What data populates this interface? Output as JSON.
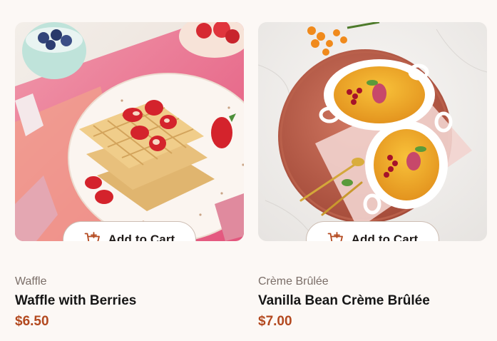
{
  "products": [
    {
      "category": "Waffle",
      "title": "Waffle with Berries",
      "price": "$6.50",
      "add_to_cart_label": "Add to Cart",
      "image_icon": "waffle-photo"
    },
    {
      "category": "Crème Brûlée",
      "title": "Vanilla Bean Crème Brûlée",
      "price": "$7.00",
      "add_to_cart_label": "Add to Cart",
      "image_icon": "creme-brulee-photo"
    }
  ],
  "colors": {
    "background": "#fcf8f5",
    "price": "#b3491f",
    "cart_icon": "#b3491f",
    "button_border": "#cdbdb3"
  },
  "icons": {
    "cart": "cart-plus-icon"
  }
}
